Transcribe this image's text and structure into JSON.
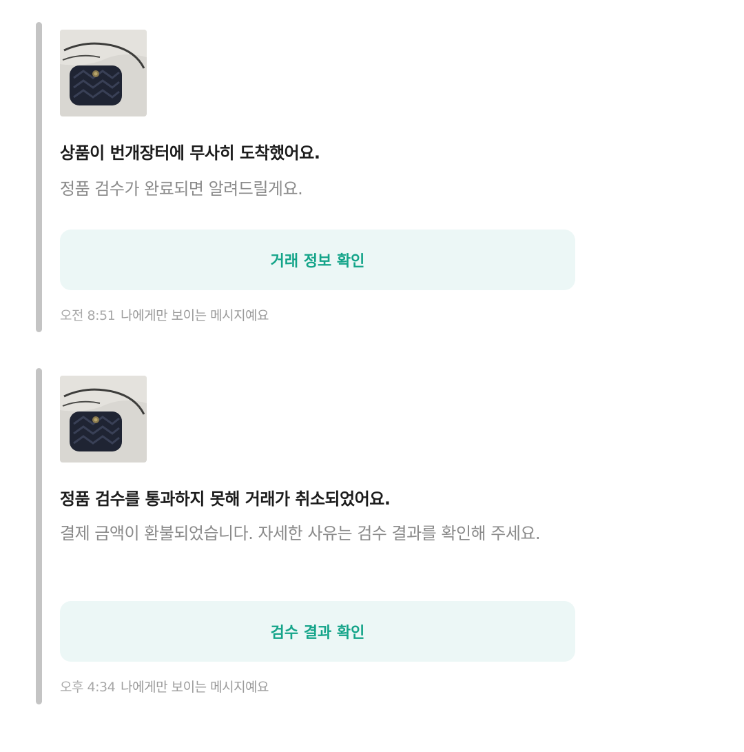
{
  "messages": [
    {
      "thumbnail": "gucci-marmont-bag-photo",
      "title": "상품이 번개장터에 무사히 도착했어요.",
      "description": "정품 검수가 완료되면 알려드릴게요.",
      "button_label": "거래 정보 확인",
      "time": "오전 8:51",
      "visibility_note": "나에게만 보이는 메시지예요"
    },
    {
      "thumbnail": "gucci-marmont-bag-photo",
      "title": "정품 검수를 통과하지 못해 거래가 취소되었어요.",
      "description": "결제 금액이 환불되었습니다. 자세한 사유는 검수 결과를 확인해 주세요.",
      "button_label": "검수 결과 확인",
      "time": "오후 4:34",
      "visibility_note": "나에게만 보이는 메시지예요"
    }
  ],
  "colors": {
    "accent_bar": "#c4c4c4",
    "button_background": "#ecf7f6",
    "button_text": "#14a489",
    "title_text": "#1c1c1c",
    "description_text": "#8a8a8a",
    "meta_text": "#9a9a9a"
  }
}
